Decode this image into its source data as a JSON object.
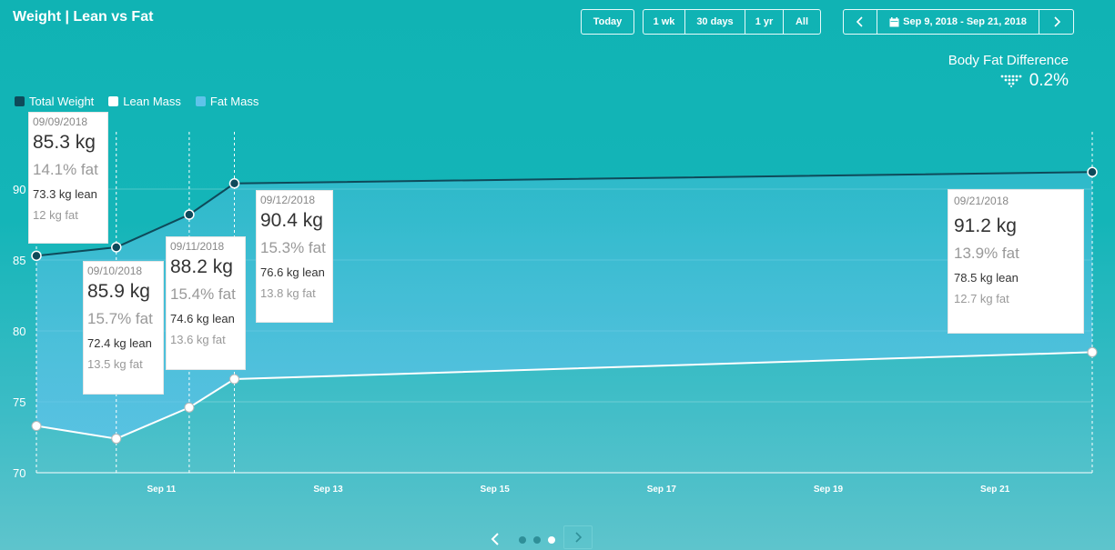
{
  "header": {
    "title": "Weight | Lean vs Fat",
    "today_label": "Today",
    "ranges": [
      "1 wk",
      "30 days",
      "1 yr",
      "All"
    ],
    "date_range": "Sep 9, 2018 - Sep 21, 2018",
    "prev_icon": "chevron-left-icon",
    "next_icon": "chevron-right-icon",
    "calendar_icon": "calendar-icon"
  },
  "summary": {
    "label": "Body Fat Difference",
    "value": "0.2%",
    "icon": "funnel-dots-icon"
  },
  "legend": [
    {
      "name": "Total Weight",
      "color": "#0e4a5a"
    },
    {
      "name": "Lean Mass",
      "color": "#ffffff"
    },
    {
      "name": "Fat Mass",
      "color": "#5fc3ea"
    }
  ],
  "tooltips": [
    {
      "date": "09/09/2018",
      "weight": "85.3 kg",
      "fat_pct": "14.1% fat",
      "lean": "73.3 kg lean",
      "fat": "12 kg fat"
    },
    {
      "date": "09/10/2018",
      "weight": "85.9 kg",
      "fat_pct": "15.7% fat",
      "lean": "72.4 kg lean",
      "fat": "13.5 kg fat"
    },
    {
      "date": "09/11/2018",
      "weight": "88.2 kg",
      "fat_pct": "15.4% fat",
      "lean": "74.6 kg lean",
      "fat": "13.6 kg fat"
    },
    {
      "date": "09/12/2018",
      "weight": "90.4 kg",
      "fat_pct": "15.3% fat",
      "lean": "76.6 kg lean",
      "fat": "13.8 kg fat"
    },
    {
      "date": "09/21/2018",
      "weight": "91.2 kg",
      "fat_pct": "13.9% fat",
      "lean": "78.5 kg lean",
      "fat": "12.7 kg fat"
    }
  ],
  "chart_data": {
    "type": "area",
    "xlabel": "",
    "ylabel": "",
    "ylim": [
      70,
      95
    ],
    "xlim": [
      "2018-09-09T12:00",
      "2018-09-22T04:00"
    ],
    "yticks": [
      70,
      75,
      80,
      85,
      90
    ],
    "xticks": [
      {
        "x": "2018-09-11",
        "label": "Sep 11"
      },
      {
        "x": "2018-09-13",
        "label": "Sep 13"
      },
      {
        "x": "2018-09-15",
        "label": "Sep 15"
      },
      {
        "x": "2018-09-17",
        "label": "Sep 17"
      },
      {
        "x": "2018-09-19",
        "label": "Sep 19"
      },
      {
        "x": "2018-09-21",
        "label": "Sep 21"
      }
    ],
    "grid": true,
    "legend_position": "top-left",
    "series": [
      {
        "name": "Total Weight",
        "x": [
          "2018-09-09T12:00",
          "2018-09-10T11:00",
          "2018-09-11T08:00",
          "2018-09-11T21:00",
          "2018-09-22T04:00"
        ],
        "values": [
          85.3,
          85.9,
          88.2,
          90.4,
          91.2
        ],
        "color": "#0e4a5a"
      },
      {
        "name": "Lean Mass",
        "x": [
          "2018-09-09T12:00",
          "2018-09-10T11:00",
          "2018-09-11T08:00",
          "2018-09-11T21:00",
          "2018-09-22T04:00"
        ],
        "values": [
          73.3,
          72.4,
          74.6,
          76.6,
          78.5
        ],
        "color": "#ffffff"
      }
    ],
    "fill_between": {
      "name": "Fat Mass",
      "upper": "Total Weight",
      "lower": "Lean Mass",
      "color": "#5fc3ea"
    }
  },
  "pager": {
    "pages": 3,
    "active": 3,
    "prev_icon": "chevron-left-icon",
    "next_icon": "chevron-right-icon"
  }
}
